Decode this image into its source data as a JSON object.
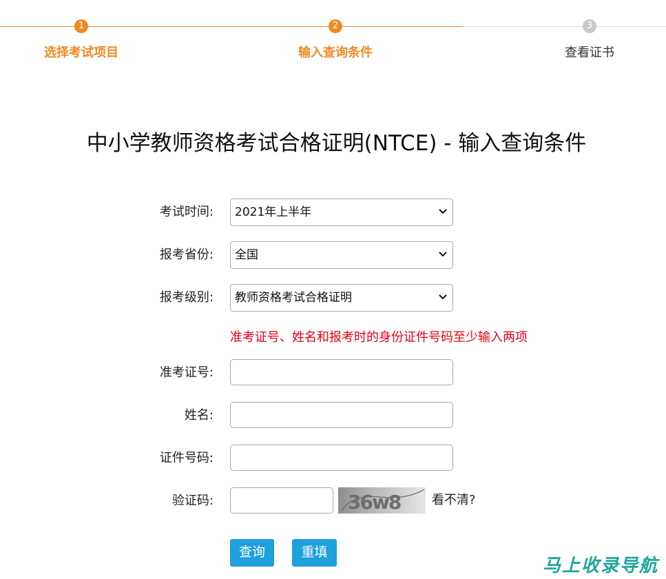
{
  "steps": [
    {
      "number": "1",
      "label": "选择考试项目",
      "state": "done"
    },
    {
      "number": "2",
      "label": "输入查询条件",
      "state": "current"
    },
    {
      "number": "3",
      "label": "查看证书",
      "state": "pending"
    }
  ],
  "colors": {
    "accent": "#f08a24",
    "button": "#1ea0dc",
    "hint": "#e60012",
    "pending": "#c8c8c8"
  },
  "page_title": "中小学教师资格考试合格证明(NTCE) - 输入查询条件",
  "form": {
    "exam_time": {
      "label": "考试时间:",
      "selected": "2021年上半年"
    },
    "province": {
      "label": "报考省份:",
      "selected": "全国"
    },
    "level": {
      "label": "报考级别:",
      "selected": "教师资格考试合格证明"
    },
    "hint": "准考证号、姓名和报考时的身份证件号码至少输入两项",
    "ticket_no": {
      "label": "准考证号:",
      "value": ""
    },
    "name": {
      "label": "姓名:",
      "value": ""
    },
    "id_no": {
      "label": "证件号码:",
      "value": ""
    },
    "captcha": {
      "label": "验证码:",
      "value": "",
      "image_text": "36w8",
      "refresh_label": "看不清?"
    }
  },
  "buttons": {
    "query": "查询",
    "reset": "重填"
  },
  "watermark": "马上收录导航"
}
